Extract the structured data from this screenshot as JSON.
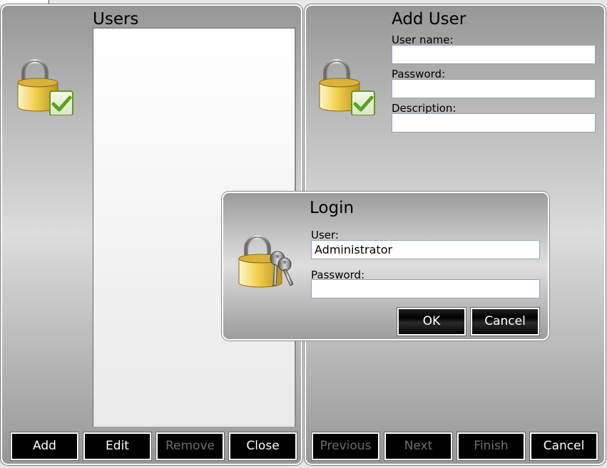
{
  "users_panel": {
    "title": "Users",
    "icon": "padlock-check-icon",
    "users_list": [],
    "buttons": [
      {
        "label": "Add",
        "enabled": true
      },
      {
        "label": "Edit",
        "enabled": true
      },
      {
        "label": "Remove",
        "enabled": false
      },
      {
        "label": "Close",
        "enabled": true
      }
    ]
  },
  "add_user_panel": {
    "title": "Add User",
    "icon": "padlock-check-icon",
    "fields": [
      {
        "label": "User name:",
        "value": ""
      },
      {
        "label": "Password:",
        "value": ""
      },
      {
        "label": "Description:",
        "value": ""
      }
    ],
    "buttons": [
      {
        "label": "Previous",
        "enabled": false
      },
      {
        "label": "Next",
        "enabled": false
      },
      {
        "label": "Finish",
        "enabled": false
      },
      {
        "label": "Cancel",
        "enabled": true
      }
    ]
  },
  "login_dialog": {
    "title": "Login",
    "icon": "padlock-keys-icon",
    "user_label": "User:",
    "user_value": "Administrator",
    "password_label": "Password:",
    "password_value": "",
    "ok_label": "OK",
    "cancel_label": "Cancel"
  },
  "colors": {
    "button_bg": "#000000",
    "button_text": "#ffffff",
    "button_disabled_text": "#6e6e6e",
    "field_border": "#8ea3bf"
  }
}
